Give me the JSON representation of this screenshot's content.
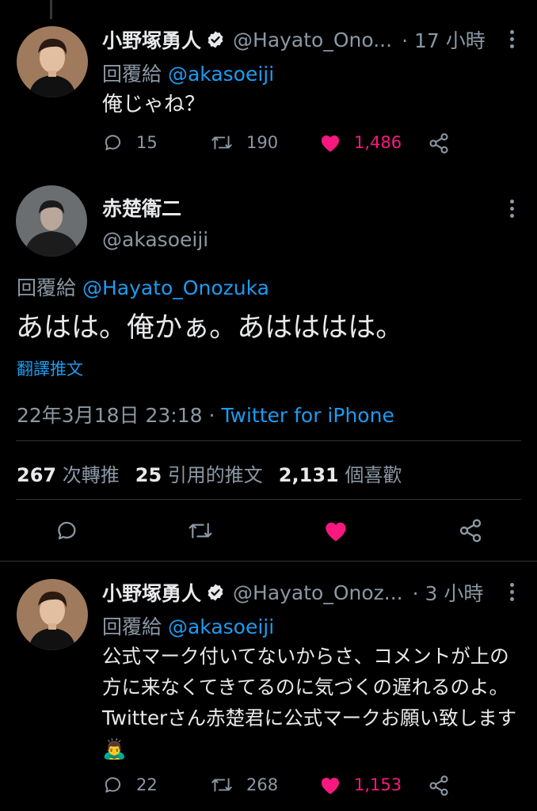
{
  "tweet1": {
    "name": "小野塚勇人",
    "handle": "@Hayato_Ono...",
    "time": "· 17 小時",
    "reply_label": "回覆給",
    "reply_handle": "@akasoeiji",
    "text": "俺じゃね？",
    "replies": "15",
    "retweets": "190",
    "likes": "1,486"
  },
  "main": {
    "name": "赤楚衛二",
    "handle": "@akasoeiji",
    "reply_label": "回覆給",
    "reply_handle": "@Hayato_Onozuka",
    "text": "あはは。俺かぁ。あはははは。",
    "translate": "翻譯推文",
    "timestamp": "22年3月18日 23:18",
    "sep": " · ",
    "client": "Twitter for iPhone",
    "retweet_count": "267",
    "retweet_label": "次轉推",
    "quote_count": "25",
    "quote_label": "引用的推文",
    "like_count": "2,131",
    "like_label": "個喜歡"
  },
  "tweet3": {
    "name": "小野塚勇人",
    "handle": "@Hayato_Onoz...",
    "time": "· 3 小時",
    "reply_label": "回覆給",
    "reply_handle": "@akasoeiji",
    "text": "公式マーク付いてないからさ、コメントが上の方に来なくてきてるのに気づくの遅れるのよ。Twitterさん赤楚君に公式マークお願い致します🙇‍♂️",
    "replies": "22",
    "retweets": "268",
    "likes": "1,153"
  },
  "colors": {
    "accent": "#1d9bf0",
    "like": "#f91880",
    "muted": "#8b98a5",
    "bg": "#000000"
  }
}
